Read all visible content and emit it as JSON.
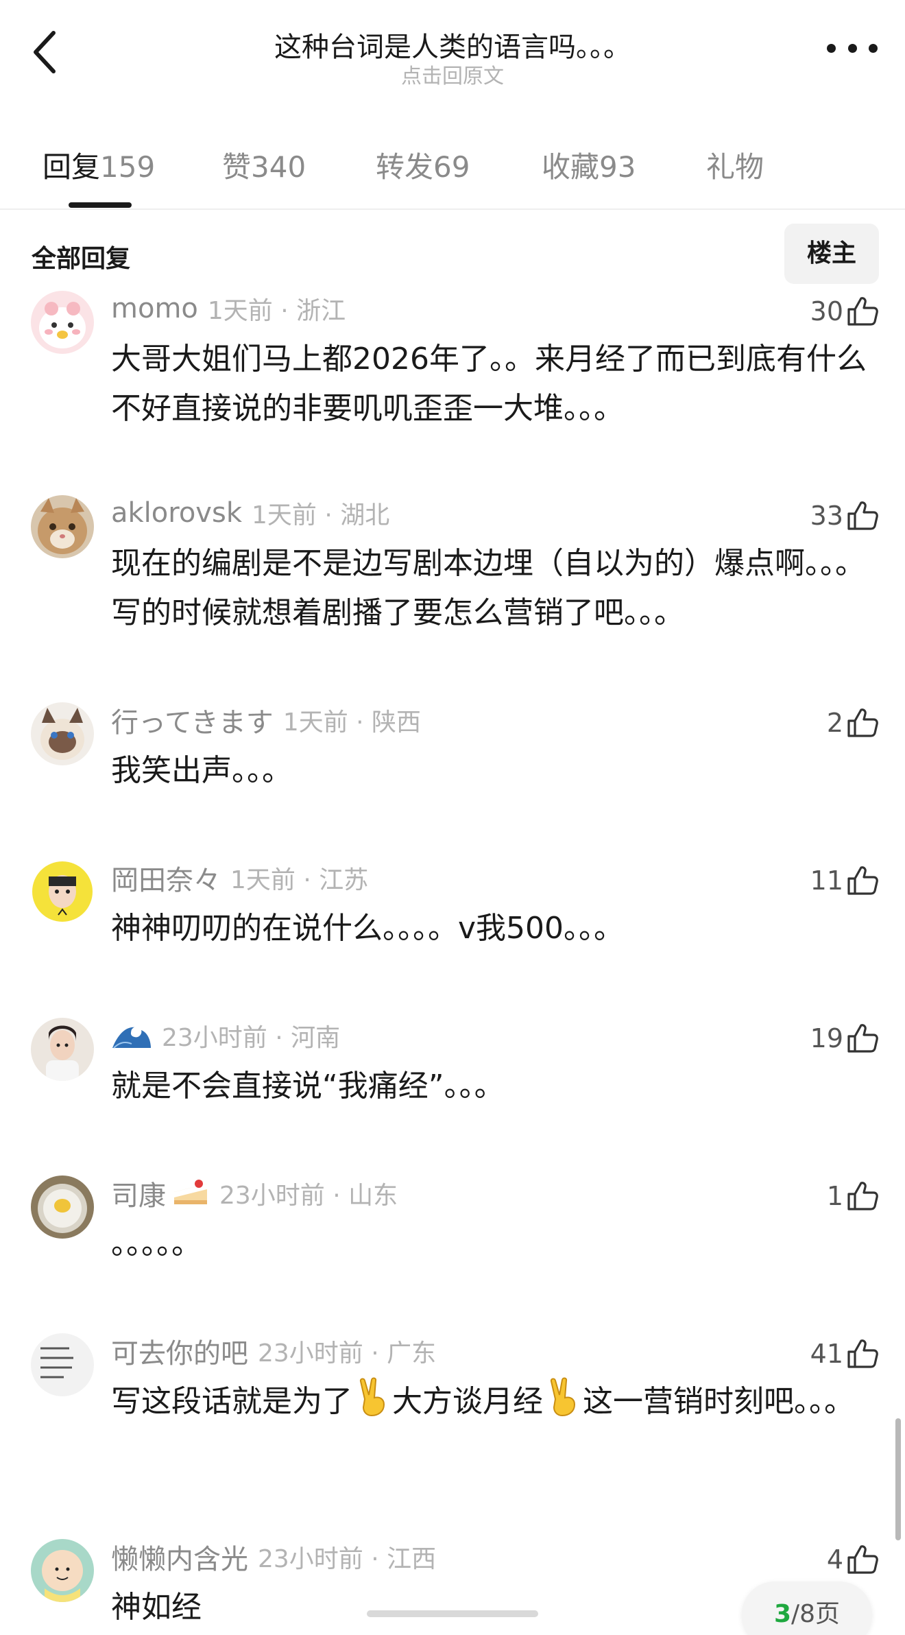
{
  "header": {
    "title": "这种台词是人类的语言吗。。。",
    "subtitle": "点击回原文",
    "back_icon": "chevron-left-icon",
    "more_icon": "more-horizontal-icon"
  },
  "tabs": [
    {
      "label": "回复",
      "count": "159",
      "active": true
    },
    {
      "label": "赞",
      "count": "340",
      "active": false
    },
    {
      "label": "转发",
      "count": "69",
      "active": false
    },
    {
      "label": "收藏",
      "count": "93",
      "active": false
    },
    {
      "label": "礼物",
      "count": "",
      "active": false
    }
  ],
  "filter": {
    "label": "全部回复",
    "op_button": "楼主"
  },
  "comments": [
    {
      "username": "momo",
      "meta": "1天前 · 浙江",
      "likes": "30",
      "content": "大哥大姐们马上都2026年了。。来月经了而已到底有什么不好直接说的非要叽叽歪歪一大堆。。。"
    },
    {
      "username": "aklorovsk",
      "meta": "1天前 · 湖北",
      "likes": "33",
      "content": "现在的编剧是不是边写剧本边埋（自以为的）爆点啊。。。写的时候就想着剧播了要怎么营销了吧。。。"
    },
    {
      "username": "行ってきます",
      "meta": "1天前 · 陕西",
      "likes": "2",
      "content": "我笑出声。。。"
    },
    {
      "username": "岡田奈々",
      "meta": "1天前 · 江苏",
      "likes": "11",
      "content": "神神叨叨的在说什么。。。。v我500。。。"
    },
    {
      "username": "",
      "username_emoji": "wave-icon",
      "meta": "23小时前 · 河南",
      "likes": "19",
      "content": "就是不会直接说“我痛经”。。。"
    },
    {
      "username": "司康",
      "username_emoji": "cake-icon",
      "meta": "23小时前 · 山东",
      "likes": "1",
      "content": "。。。。。"
    },
    {
      "username": "可去你的吧",
      "meta": "23小时前 · 广东",
      "likes": "41",
      "content_parts": [
        "写这段话就是为了",
        "大方谈月经",
        "这一营销时刻吧。。。"
      ],
      "inline_emoji": "victory-hand-icon"
    },
    {
      "username": "懒懒内含光",
      "meta": "23小时前 · 江西",
      "likes": "4",
      "content": "神如经"
    }
  ],
  "pagination": {
    "current": "3",
    "total_text": "/8页"
  },
  "colors": {
    "accent_green": "#1fa83f",
    "text_primary": "#1a1a1a",
    "text_secondary": "#8a8a8a",
    "text_tertiary": "#b3b3b3"
  }
}
